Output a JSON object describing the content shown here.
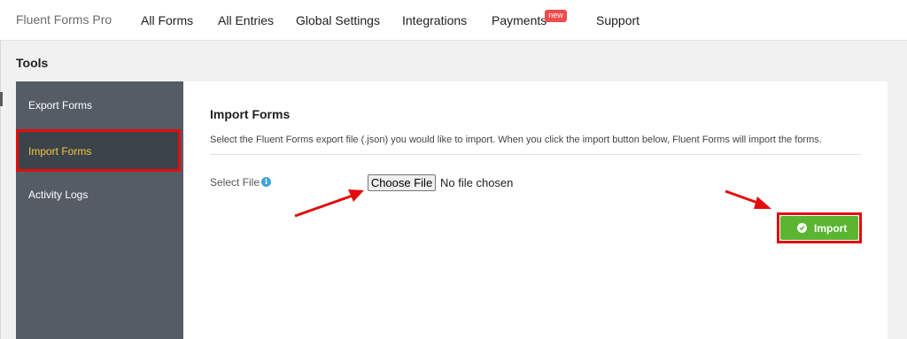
{
  "header": {
    "brand": "Fluent Forms Pro",
    "nav": [
      "All Forms",
      "All Entries",
      "Global Settings",
      "Integrations",
      "Payments",
      "Support"
    ],
    "badge": "new"
  },
  "page": {
    "title": "Tools"
  },
  "sidebar": {
    "items": [
      {
        "label": "Export Forms"
      },
      {
        "label": "Import Forms",
        "active": true
      },
      {
        "label": "Activity Logs"
      }
    ]
  },
  "main": {
    "title": "Import Forms",
    "description": "Select the Fluent Forms export file (.json) you would like to import. When you click the import button below, Fluent Forms will import the forms.",
    "file_label": "Select File",
    "choose_button": "Choose File",
    "no_file_text": "No file chosen",
    "import_button": "Import"
  },
  "colors": {
    "sidebar": "#545d66",
    "active_item_text": "#f5c542",
    "highlight": "#e30d0d",
    "import_button": "#5bb531",
    "badge": "#f24b4b"
  },
  "icons": [
    "info-icon",
    "check-circle-icon",
    "annotation-arrow"
  ]
}
